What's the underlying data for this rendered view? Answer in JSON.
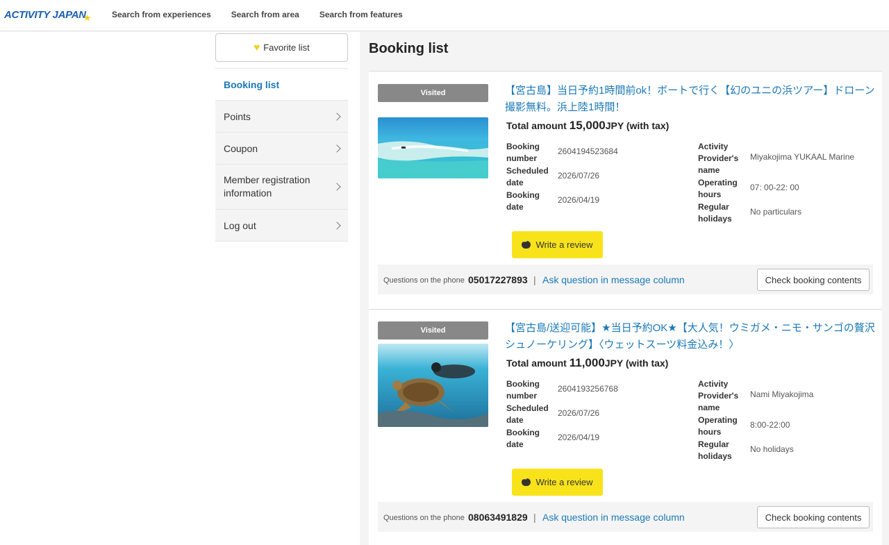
{
  "header": {
    "logo_text": "ACTIVITY JAPAN",
    "nav": [
      "Search from experiences",
      "Search from area",
      "Search from features"
    ]
  },
  "sidebar": {
    "favorite_label": "Favorite list",
    "items": [
      {
        "label": "Booking list",
        "active": true
      },
      {
        "label": "Points"
      },
      {
        "label": "Coupon"
      },
      {
        "label": "Member registration information"
      },
      {
        "label": "Log out"
      }
    ]
  },
  "main": {
    "title": "Booking list",
    "labels": {
      "visited": "Visited",
      "total_prefix": "Total amount",
      "tax_suffix": "JPY (with tax)",
      "booking_number": "Booking number",
      "scheduled_date": "Scheduled date",
      "booking_date": "Booking date",
      "provider_name": "Activity Provider's name",
      "operating_hours": "Operating hours",
      "regular_holidays": "Regular holidays",
      "write_review": "Write a review",
      "questions_phone": "Questions on the phone",
      "ask_message": "Ask question in message column",
      "check_contents": "Check booking contents",
      "separator": "|"
    },
    "bookings": [
      {
        "status": "Visited",
        "title": "【宮古島】当日予約1時間前ok！ボートで行く【幻のユニの浜ツアー】ドローン撮影無料。浜上陸1時間！",
        "amount": "15,000",
        "booking_number": "2604194523684",
        "scheduled_date": "2026/07/26",
        "booking_date": "2026/04/19",
        "provider_name": "Miyakojima YUKAAL Marine",
        "operating_hours": "07: 00-22: 00",
        "regular_holidays": "No particulars",
        "phone": "05017227893"
      },
      {
        "status": "Visited",
        "title": "【宮古島/送迎可能】★当日予約OK★【大人気！ウミガメ・ニモ・サンゴの贅沢シュノーケリング】〈ウェットスーツ料金込み！〉",
        "amount": "11,000",
        "booking_number": "2604193256768",
        "scheduled_date": "2026/07/26",
        "booking_date": "2026/04/19",
        "provider_name": "Nami Miyakojima",
        "operating_hours": "8:00-22:00",
        "regular_holidays": "No holidays",
        "phone": "08063491829"
      }
    ]
  },
  "colors": {
    "link_blue": "#1a78b8",
    "review_yellow": "#f8e31b",
    "visited_gray": "#888888",
    "logo_blue": "#1a5fb4"
  }
}
